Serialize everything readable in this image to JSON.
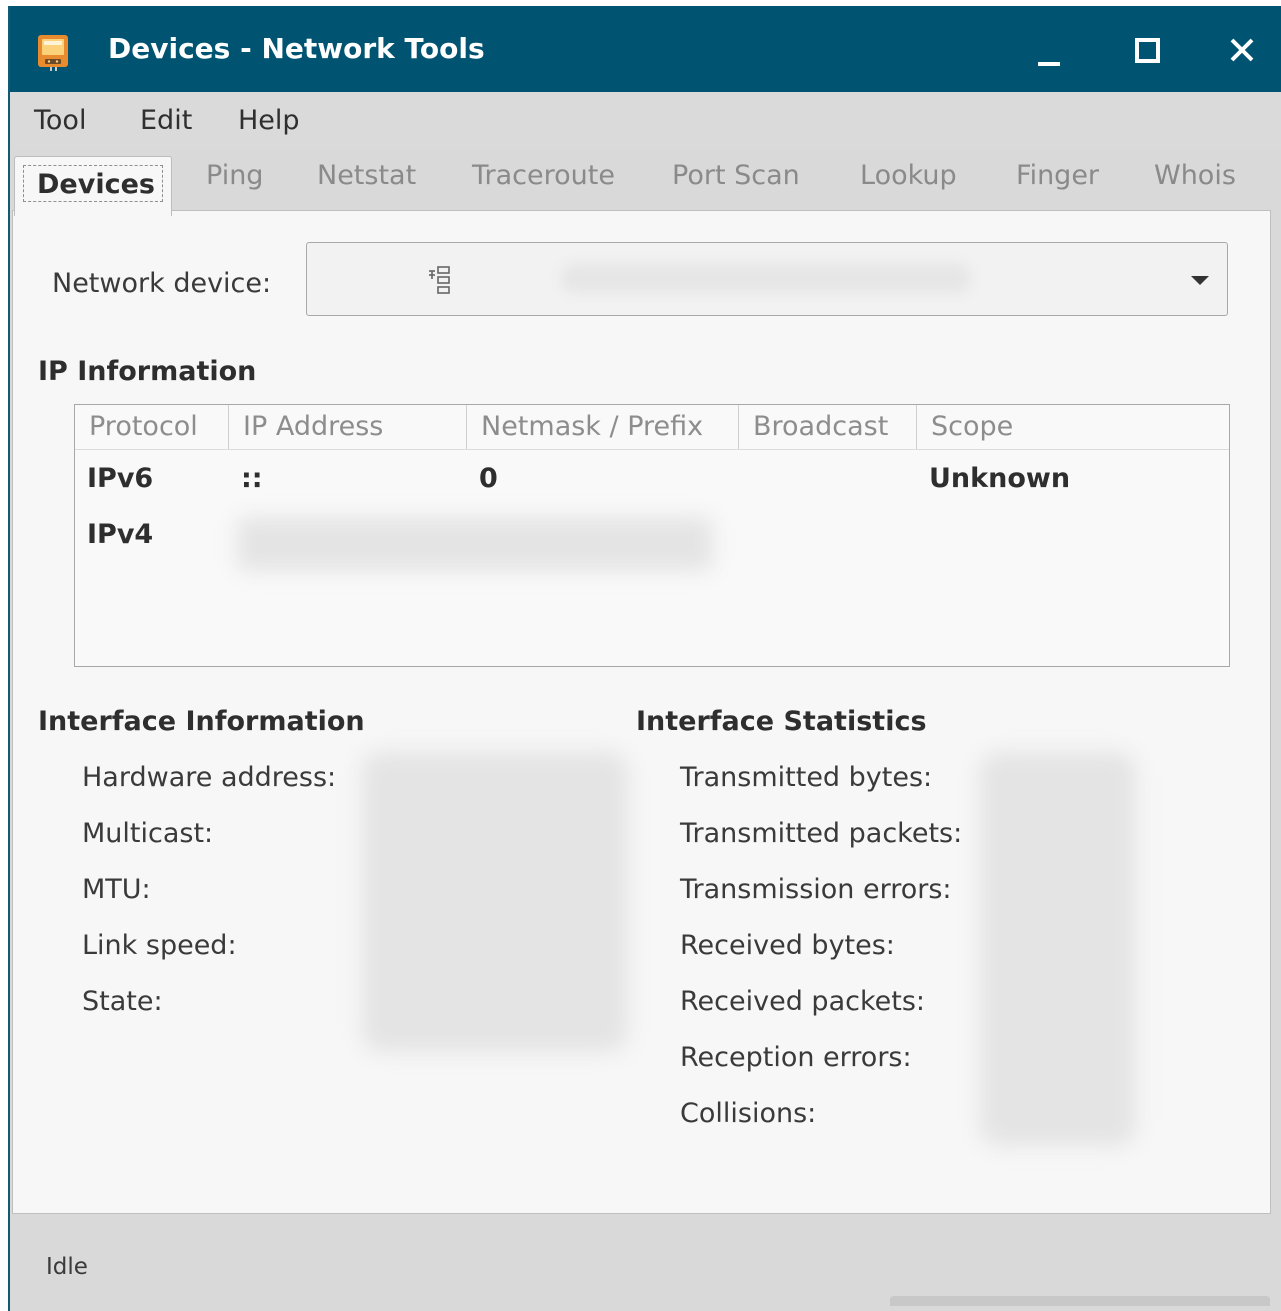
{
  "window": {
    "title": "Devices - Network Tools",
    "accent_color": "#005471",
    "icons": {
      "app": "network-tools-icon",
      "minimize": "minimize-icon",
      "maximize": "maximize-icon",
      "close": "close-icon"
    }
  },
  "menu": {
    "items": [
      "Tool",
      "Edit",
      "Help"
    ]
  },
  "tabs": {
    "items": [
      "Devices",
      "Ping",
      "Netstat",
      "Traceroute",
      "Port Scan",
      "Lookup",
      "Finger",
      "Whois"
    ],
    "active": "Devices"
  },
  "device": {
    "label": "Network device:",
    "icon": "network-interface-icon"
  },
  "ip_info": {
    "heading": "IP Information",
    "columns": [
      "Protocol",
      "IP Address",
      "Netmask / Prefix",
      "Broadcast",
      "Scope"
    ],
    "rows": [
      {
        "protocol": "IPv6",
        "address": "::",
        "netmask": "0",
        "broadcast": "",
        "scope": "Unknown"
      },
      {
        "protocol": "IPv4",
        "address": "",
        "netmask": "",
        "broadcast": "",
        "scope": ""
      }
    ]
  },
  "interface_info": {
    "heading": "Interface Information",
    "labels": [
      "Hardware address:",
      "Multicast:",
      "MTU:",
      "Link speed:",
      "State:"
    ]
  },
  "interface_stats": {
    "heading": "Interface Statistics",
    "labels": [
      "Transmitted bytes:",
      "Transmitted packets:",
      "Transmission errors:",
      "Received bytes:",
      "Received packets:",
      "Reception errors:",
      "Collisions:"
    ]
  },
  "status": {
    "text": "Idle"
  }
}
